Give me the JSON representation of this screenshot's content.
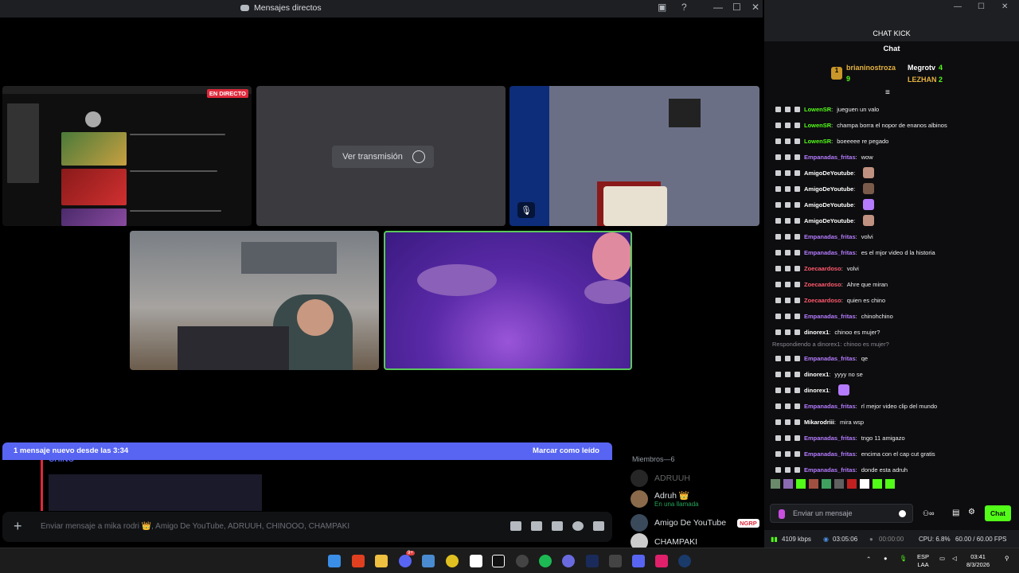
{
  "discord": {
    "title": "Mensajes directos",
    "live_badge": "EN DIRECTO",
    "watch_stream": "Ver transmisión",
    "new_messages": "1 mensaje nuevo desde las 3:34",
    "mark_read": "Marcar como leído",
    "partial_author": "CHINO",
    "message_placeholder": "Enviar mensaje a mika rodri 👑, Amigo De YouTube, ADRUUH, CHINOOO, CHAMPAKI",
    "members_header": "Miembros—6",
    "members": [
      {
        "name": "ADRUUH",
        "sub": ""
      },
      {
        "name": "Adruh 👑",
        "sub": "En una llamada"
      },
      {
        "name": "Amigo De YouTube",
        "sub": "",
        "tag": "NGRP"
      },
      {
        "name": "CHAMPAKI",
        "sub": ""
      }
    ]
  },
  "kick": {
    "window_title": "CHAT KICK",
    "chat_title": "Chat",
    "leaders": [
      {
        "rank": "1",
        "name": "brianinostroza",
        "count": "9"
      },
      {
        "name": "Megrotv",
        "count": "4"
      },
      {
        "name": "LEZHAN",
        "count": "2"
      }
    ],
    "messages": [
      {
        "user": "LowenSR",
        "text": "jueguen un valo",
        "color": "#53fc18"
      },
      {
        "user": "LowenSR",
        "text": "champa borra el nopor de enanos albinos",
        "color": "#53fc18"
      },
      {
        "user": "LowenSR",
        "text": "boeeeee re pegado",
        "color": "#53fc18"
      },
      {
        "user": "Empanadas_fritas",
        "text": "wow",
        "color": "#b57bff"
      },
      {
        "user": "AmigoDeYoutube",
        "text": "",
        "color": "#ffffff"
      },
      {
        "user": "AmigoDeYoutube",
        "text": "",
        "color": "#ffffff"
      },
      {
        "user": "AmigoDeYoutube",
        "text": "",
        "color": "#ffffff"
      },
      {
        "user": "AmigoDeYoutube",
        "text": "",
        "color": "#ffffff"
      },
      {
        "user": "Empanadas_fritas",
        "text": "volvi",
        "color": "#b57bff"
      },
      {
        "user": "Empanadas_fritas",
        "text": "es el mjor video d la historia",
        "color": "#b57bff"
      },
      {
        "user": "Zoecaardoso",
        "text": "volvi",
        "color": "#ff5a6e"
      },
      {
        "user": "Zoecaardoso",
        "text": "Ahre que miran",
        "color": "#ff5a6e"
      },
      {
        "user": "Zoecaardoso",
        "text": "quien es chino",
        "color": "#ff5a6e"
      },
      {
        "user": "Empanadas_fritas",
        "text": "chinohchino",
        "color": "#b57bff"
      },
      {
        "user": "dinorex1",
        "text": "chinoo es mujer?",
        "color": "#ffffff"
      },
      {
        "reply": "Respondiendo a dinorex1: chinoo es mujer?"
      },
      {
        "user": "Empanadas_fritas",
        "text": "qe",
        "color": "#b57bff"
      },
      {
        "user": "dinorex1",
        "text": "yyyy no se",
        "color": "#ffffff"
      },
      {
        "user": "dinorex1",
        "text": "",
        "color": "#ffffff"
      },
      {
        "user": "Empanadas_fritas",
        "text": "rl mejor video clip del mundo",
        "color": "#b57bff"
      },
      {
        "user": "Mikarodriii",
        "text": "mira wsp",
        "color": "#ffffff"
      },
      {
        "user": "Empanadas_fritas",
        "text": "tngo 11 amigazo",
        "color": "#b57bff"
      },
      {
        "user": "Empanadas_fritas",
        "text": "encima con el cap cut gratis",
        "color": "#b57bff"
      },
      {
        "user": "Empanadas_fritas",
        "text": "donde esta adruh",
        "color": "#b57bff"
      }
    ],
    "input_placeholder": "Enviar un mensaje",
    "send_button": "Chat",
    "stats": {
      "bitrate": "4109 kbps",
      "uptime": "03:05:06",
      "rec": "00:00:00",
      "cpu": "CPU: 6.8%",
      "fps": "60.00 / 60.00 FPS"
    }
  },
  "taskbar": {
    "lang1": "ESP",
    "lang2": "LAA",
    "time": "03:41",
    "date": "8/3/2026",
    "discord_badge": "9+"
  }
}
